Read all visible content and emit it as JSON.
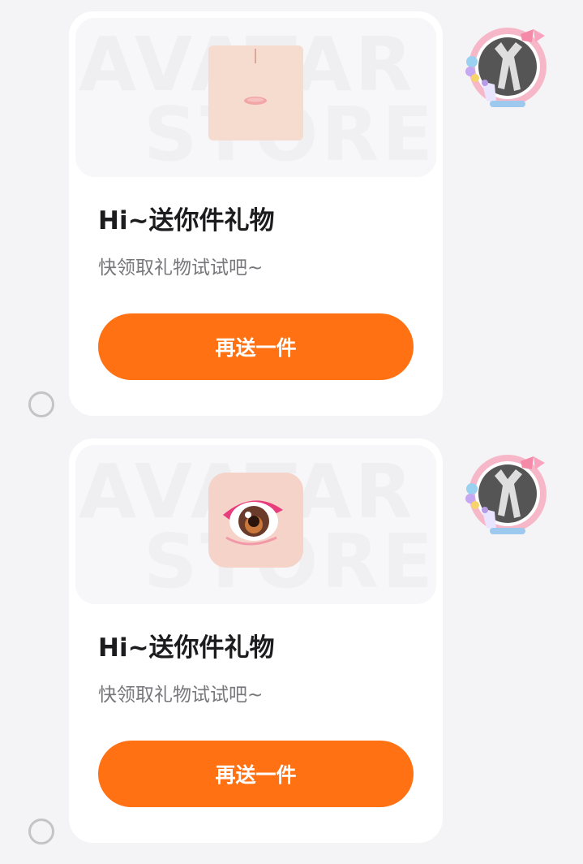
{
  "colors": {
    "page_background": "#f4f4f6",
    "card_background": "#ffffff",
    "button_background": "#ff7113",
    "button_text": "#ffffff",
    "title_text": "#1c1c1e",
    "subtitle_text": "#77777c"
  },
  "watermark": {
    "line1": "AVATAR",
    "line2": "STORE"
  },
  "messages": [
    {
      "gift_icon": "face-mouth-item-icon",
      "title": "Hi~送你件礼物",
      "subtitle": "快领取礼物试试吧~",
      "button_label": "再送一件",
      "avatar_icon": "user-avatar-with-decorative-frame"
    },
    {
      "gift_icon": "anime-eye-item-icon",
      "title": "Hi~送你件礼物",
      "subtitle": "快领取礼物试试吧~",
      "button_label": "再送一件",
      "avatar_icon": "user-avatar-with-decorative-frame"
    }
  ]
}
